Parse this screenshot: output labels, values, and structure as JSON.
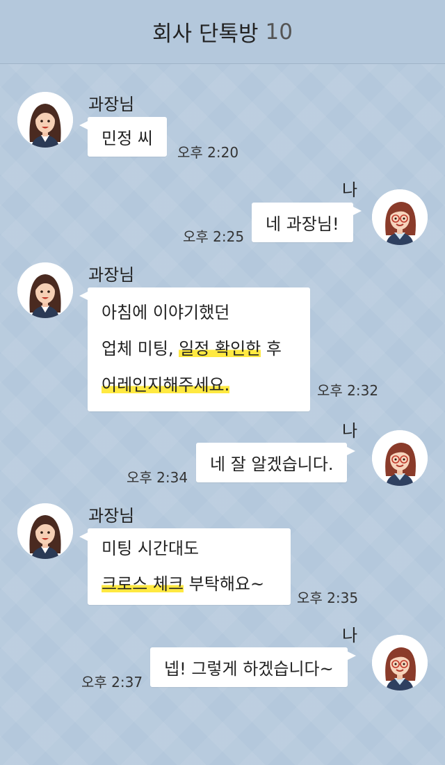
{
  "header": {
    "title": "회사 단톡방",
    "member_count": "10"
  },
  "icons": {
    "manager_avatar": "woman-long-hair-avatar",
    "me_avatar": "woman-glasses-avatar"
  },
  "colors": {
    "background": "#b4c8dc",
    "bubble": "#ffffff",
    "highlight": "#ffe941"
  },
  "messages": [
    {
      "sender": "과장님",
      "time": "오후 2:20",
      "lines": [
        "민정 씨"
      ]
    },
    {
      "sender": "나",
      "time": "오후 2:25",
      "lines": [
        "네 과장님!"
      ]
    },
    {
      "sender": "과장님",
      "time": "오후 2:32",
      "lines": [
        "아침에 이야기했던"
      ],
      "line2_a": "업체 미팅, ",
      "line2_b": "일정 확인한",
      "line2_c": " 후",
      "line3_hl": "어레인지해주세요."
    },
    {
      "sender": "나",
      "time": "오후 2:34",
      "lines": [
        "네 잘 알겠습니다."
      ]
    },
    {
      "sender": "과장님",
      "time": "오후 2:35",
      "lines": [
        "미팅 시간대도"
      ],
      "line2_hl": "크로스 체크",
      "line2_rest": " 부탁해요~"
    },
    {
      "sender": "나",
      "time": "오후 2:37",
      "lines": [
        "넵! 그렇게 하겠습니다~"
      ]
    }
  ]
}
